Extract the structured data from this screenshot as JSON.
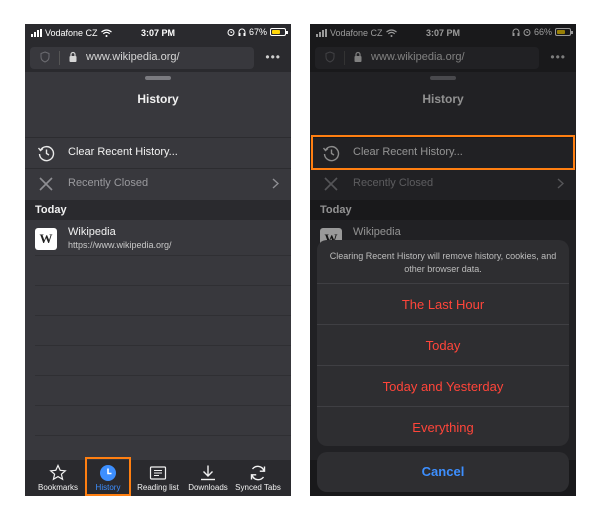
{
  "status": {
    "carrier": "Vodafone CZ",
    "left_time": "3:07 PM",
    "left_battery": "67%",
    "right_time": "3:07 PM",
    "right_battery": "66%",
    "left_battery_level": 0.67,
    "right_battery_level": 0.66
  },
  "url_bar": {
    "url": "www.wikipedia.org/",
    "more_label": "•••"
  },
  "history_panel": {
    "title": "History",
    "clear_label": "Clear Recent History...",
    "recently_closed_label": "Recently Closed",
    "section_today": "Today",
    "items": [
      {
        "title": "Wikipedia",
        "url": "https://www.wikipedia.org/",
        "icon_letter": "W"
      }
    ]
  },
  "tabbar": {
    "tabs": [
      {
        "label": "Bookmarks",
        "icon": "star-icon"
      },
      {
        "label": "History",
        "icon": "clock-icon"
      },
      {
        "label": "Reading list",
        "icon": "book-icon"
      },
      {
        "label": "Downloads",
        "icon": "download-icon"
      },
      {
        "label": "Synced Tabs",
        "icon": "sync-icon"
      }
    ],
    "active_tab": "History"
  },
  "action_sheet": {
    "message": "Clearing Recent History will remove history, cookies, and other browser data.",
    "options": [
      "The Last Hour",
      "Today",
      "Today and Yesterday",
      "Everything"
    ],
    "cancel_label": "Cancel"
  },
  "colors": {
    "highlight": "#ff7f11",
    "destructive": "#ff453a",
    "cancel": "#3d8fff",
    "active_tab": "#3d8fff",
    "battery": "#ffd60a"
  }
}
